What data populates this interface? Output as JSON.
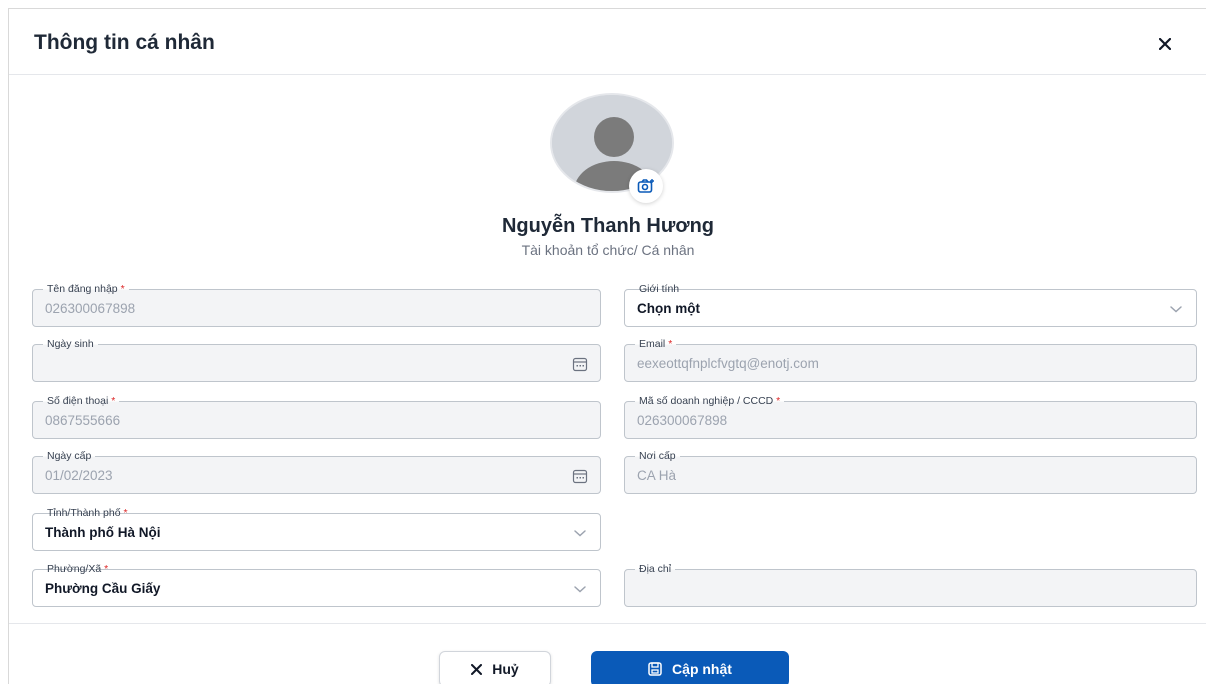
{
  "modal": {
    "title": "Thông tin cá nhân"
  },
  "profile": {
    "name": "Nguyễn Thanh Hương",
    "account_type": "Tài khoản tổ chức/ Cá nhân"
  },
  "fields": {
    "username": {
      "label": "Tên đăng nhập",
      "value": "026300067898",
      "required": true
    },
    "gender": {
      "label": "Giới tính",
      "value": "Chọn một",
      "required": false
    },
    "dob": {
      "label": "Ngày sinh",
      "value": "",
      "required": false
    },
    "email": {
      "label": "Email",
      "value": "eexeottqfnplcfvgtq@enotj.com",
      "required": true
    },
    "phone": {
      "label": "Số điện thoại",
      "value": "0867555666",
      "required": true
    },
    "tax_id": {
      "label": "Mã số doanh nghiệp / CCCD",
      "value": "026300067898",
      "required": true
    },
    "issue_date": {
      "label": "Ngày cấp",
      "value": "01/02/2023",
      "required": false
    },
    "issue_place": {
      "label": "Nơi cấp",
      "value": "CA Hà",
      "required": false
    },
    "province": {
      "label": "Tỉnh/Thành phố",
      "value": "Thành phố Hà Nội",
      "required": true
    },
    "ward": {
      "label": "Phường/Xã",
      "value": "Phường Cầu Giấy",
      "required": true
    },
    "address": {
      "label": "Địa chỉ",
      "value": "",
      "required": false
    }
  },
  "required_mark": "*",
  "footer": {
    "cancel_label": "Huỷ",
    "save_label": "Cập nhật"
  },
  "colors": {
    "primary": "#0a5ab8",
    "required": "#dc2626",
    "disabled_bg": "#f3f4f6"
  },
  "icons": {
    "close": "close-icon",
    "camera": "camera-icon",
    "calendar": "calendar-icon",
    "chevron": "chevron-down-icon",
    "save": "save-icon"
  }
}
